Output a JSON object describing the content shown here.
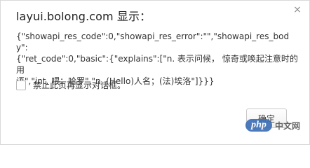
{
  "dialog": {
    "title": "layui.bolong.com 显示：",
    "close_glyph": "×",
    "message": "{\"showapi_res_code\":0,\"showapi_res_error\":\"\",\"showapi_res_body\":\n{\"ret_code\":0,\"basic\":{\"explains\":[\"n. 表示问候， 惊奇或唤起注意时的用\n语\",\"int. 喂；哈罗\",\"n. (Hello)人名；(法)埃洛\"]}}}",
    "suppress_label": "禁止此页再显示对话框。",
    "suppress_checked": false,
    "ok_label": "确定"
  },
  "watermark": {
    "logo_text": "php",
    "site_text": "中文网",
    "color": "#3d6fb6"
  }
}
